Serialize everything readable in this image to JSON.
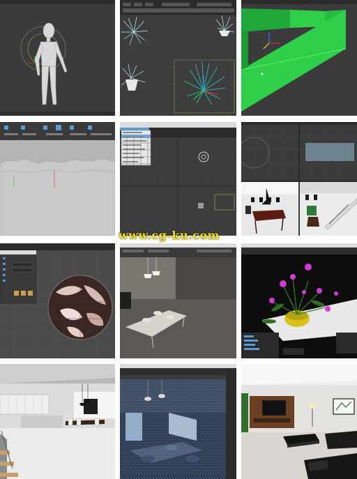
{
  "watermark": {
    "text": "www.cg-ku.com"
  },
  "tiles": [
    {
      "id": "mannequin-viewport"
    },
    {
      "id": "plant-instances-viewport"
    },
    {
      "id": "green-walls-viewport"
    },
    {
      "id": "ribbon-terrain-viewport"
    },
    {
      "id": "workspace-menu-viewport"
    },
    {
      "id": "quad-view-stairs"
    },
    {
      "id": "material-sphere-viewport"
    },
    {
      "id": "dining-room-render"
    },
    {
      "id": "flowers-render"
    },
    {
      "id": "kitchen-interior-render"
    },
    {
      "id": "noisy-dining-render"
    },
    {
      "id": "living-room-render"
    }
  ],
  "colors": {
    "viewport_bg": "#3b3b3b",
    "wall_green": "#2fcf4a",
    "flower_magenta": "#d23ad8",
    "plant_cyan": "#29c7c9",
    "watermark_yellow": "#f2e21a"
  },
  "icons": [
    "gizmo-icon",
    "navigation-cube-icon"
  ]
}
